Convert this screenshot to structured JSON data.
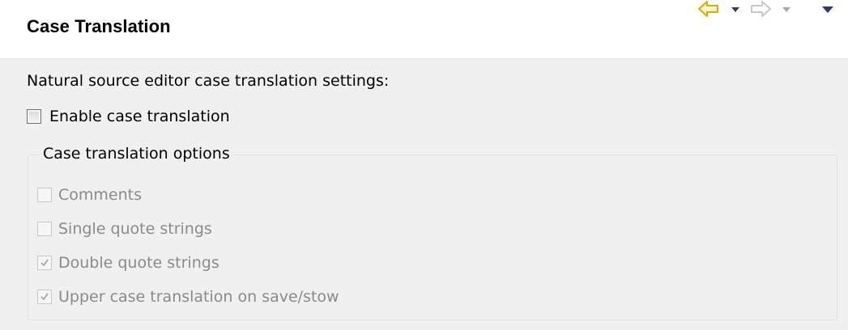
{
  "header": {
    "title": "Case Translation",
    "nav": {
      "back_icon": "back-arrow-icon",
      "forward_icon": "forward-arrow-icon",
      "menu_icon": "view-menu-icon",
      "back_color": "#e8b400",
      "forward_color": "#c8c8c8",
      "dropdown_color": "#3c3c50"
    }
  },
  "content": {
    "description": "Natural source editor case translation settings:",
    "enable": {
      "label": "Enable case translation",
      "checked": false
    },
    "options_group": {
      "legend": "Case translation options",
      "options": [
        {
          "label": "Comments",
          "checked": false,
          "enabled": false
        },
        {
          "label": "Single quote strings",
          "checked": false,
          "enabled": false
        },
        {
          "label": "Double quote strings",
          "checked": true,
          "enabled": false
        },
        {
          "label": "Upper case translation on save/stow",
          "checked": true,
          "enabled": false
        }
      ]
    }
  }
}
